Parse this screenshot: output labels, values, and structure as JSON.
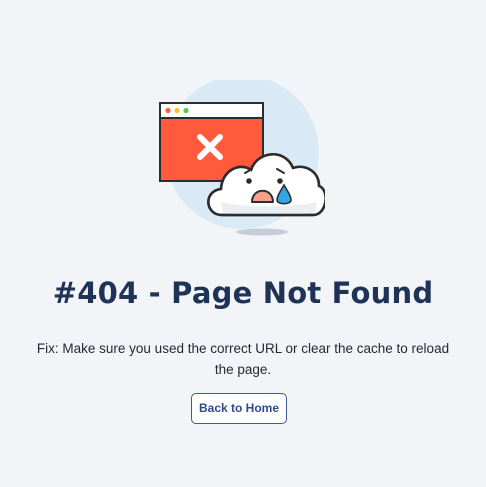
{
  "error": {
    "title": "#404 - Page Not Found",
    "message": "Fix: Make sure you used the correct URL or clear the cache to reload the page.",
    "illustration_icons": [
      "browser-window-error-icon",
      "sad-cloud-icon"
    ]
  },
  "actions": {
    "back_home_label": "Back to Home"
  },
  "colors": {
    "background": "#f2f4f8",
    "title": "#1e3355",
    "button_border": "#3d5a9a",
    "error_window": "#ff5a3c",
    "circle": "#d9eaf6"
  }
}
